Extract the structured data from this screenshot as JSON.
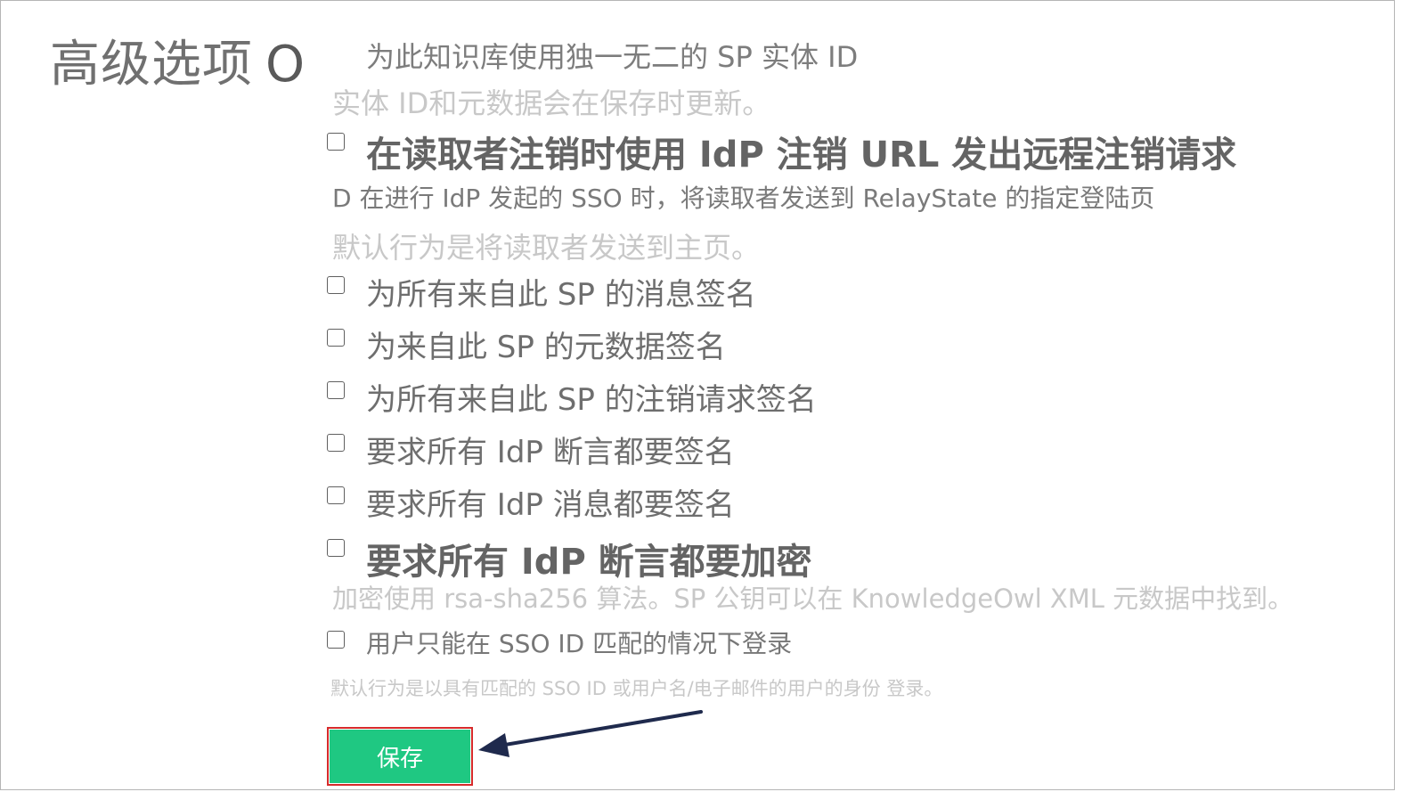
{
  "section": {
    "title": "高级选项",
    "title_suffix": "O"
  },
  "entity_id": {
    "label": "为此知识库使用独一无二的 SP 实体 ID",
    "note": "实体 ID和元数据会在保存时更新。"
  },
  "options": {
    "remote_logout": "在读取者注销时使用 IdP 注销 URL 发出远程注销请求",
    "relay_state": "D 在进行 IdP 发起的 SSO 时，将读取者发送到 RelayState 的指定登陆页",
    "relay_state_note": "默认行为是将读取者发送到主页。",
    "sign_messages": "为所有来自此 SP 的消息签名",
    "sign_metadata": "为来自此 SP 的元数据签名",
    "sign_logout": "为所有来自此 SP 的注销请求签名",
    "require_assertion_signed": "要求所有 IdP 断言都要签名",
    "require_message_signed": "要求所有 IdP 消息都要签名",
    "require_assertion_encrypted": "要求所有 IdP 断言都要加密",
    "encryption_note": "加密使用 rsa-sha256 算法。SP 公钥可以在 KnowledgeOwl  XML 元数据中找到。",
    "sso_id_only": "用户只能在 SSO ID 匹配的情况下登录",
    "sso_id_note": "默认行为是以具有匹配的 SSO ID 或用户名/电子邮件的用户的身份 登录。"
  },
  "save": {
    "label": "保存"
  },
  "colors": {
    "accent": "#1fc882",
    "highlight": "#d62b2b",
    "arrow": "#1f2a4d"
  }
}
